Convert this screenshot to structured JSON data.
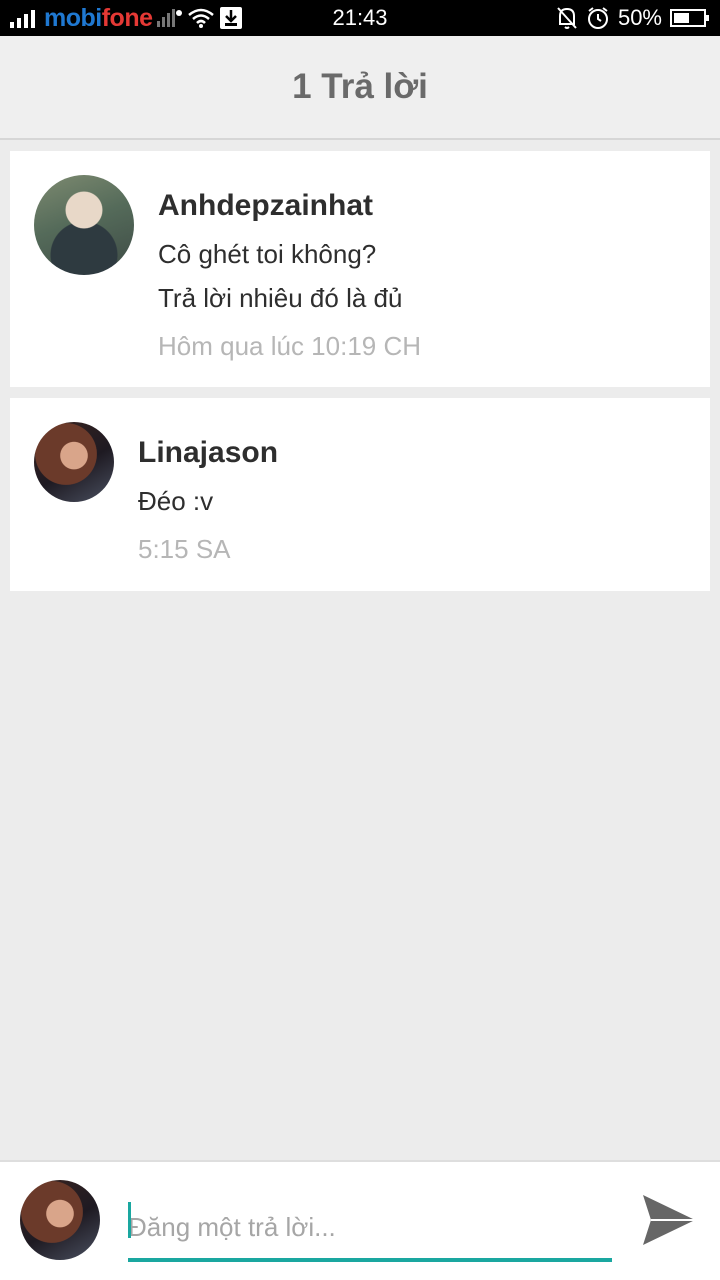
{
  "status_bar": {
    "carrier_part1": "mobi",
    "carrier_part2": "fone",
    "time": "21:43",
    "battery": "50%"
  },
  "header": {
    "title": "1 Trả lời"
  },
  "comments": [
    {
      "username": "Anhdepzainhat",
      "lines": [
        "Cô ghét toi không?",
        "Trả lời nhiêu đó là đủ"
      ],
      "time": "Hôm qua lúc 10:19 CH"
    },
    {
      "username": "Linajason",
      "lines": [
        "Đéo :v"
      ],
      "time": "5:15 SA"
    }
  ],
  "reply_box": {
    "placeholder": "Đăng một trả lời..."
  },
  "colors": {
    "accent": "#1aa7a0",
    "header_text": "#6a6a6a",
    "time_text": "#b6b6b6"
  }
}
